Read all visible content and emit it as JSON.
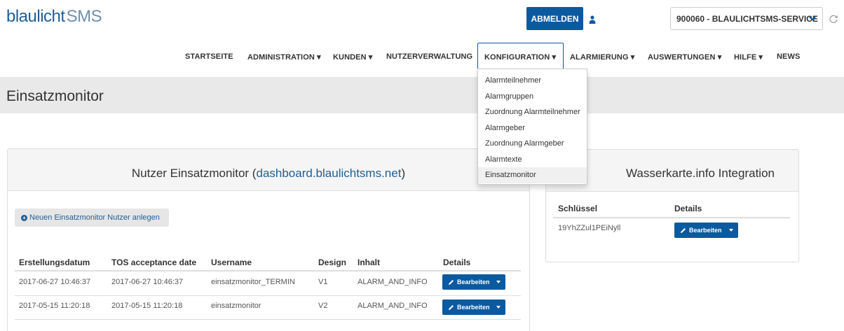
{
  "header": {
    "logo_main": "blaulicht",
    "logo_sub": "SMS",
    "logout_label": "ABMELDEN",
    "org_selected": "900060 - BLAULICHTSMS-SERVICE"
  },
  "nav": {
    "items": [
      "STARTSEITE",
      "ADMINISTRATION ▾",
      "KUNDEN ▾",
      "NUTZERVERWALTUNG",
      "KONFIGURATION ▾",
      "ALARMIERUNG ▾",
      "AUSWERTUNGEN ▾",
      "HILFE ▾",
      "NEWS"
    ],
    "active_index": 4,
    "dropdown": [
      "Alarmteilnehmer",
      "Alarmgruppen",
      "Zuordnung Alarmteilnehmer",
      "Alarmgeber",
      "Zuordnung Alarmgeber",
      "Alarmtexte",
      "Einsatzmonitor"
    ],
    "dropdown_selected_index": 6
  },
  "page": {
    "title": "Einsatzmonitor"
  },
  "left_panel": {
    "title_prefix": "Nutzer Einsatzmonitor (",
    "title_link": "dashboard.blaulichtsms.net",
    "title_suffix": ")",
    "new_user_label": "Neuen Einsatzmonitor Nutzer anlegen",
    "columns": [
      "Erstellungsdatum",
      "TOS acceptance date",
      "Username",
      "Design",
      "Inhalt",
      "Details"
    ],
    "rows": [
      [
        "2017-06-27 10:46:37",
        "2017-06-27 10:46:37",
        "einsatzmonitor_TERMIN",
        "V1",
        "ALARM_AND_INFO",
        "Bearbeiten"
      ],
      [
        "2017-05-15 11:20:18",
        "2017-05-15 11:20:18",
        "einsatzmonitor",
        "V2",
        "ALARM_AND_INFO",
        "Bearbeiten"
      ]
    ]
  },
  "right_panel": {
    "title": "Wasserkarte.info Integration",
    "columns": [
      "Schlüssel",
      "Details"
    ],
    "rows": [
      [
        "19YhZZul1PEiNyll",
        "Bearbeiten"
      ]
    ]
  },
  "colors": {
    "primary": "#0b5aa0",
    "link": "#1f5f96",
    "title_bar": "#e9e9e9"
  }
}
